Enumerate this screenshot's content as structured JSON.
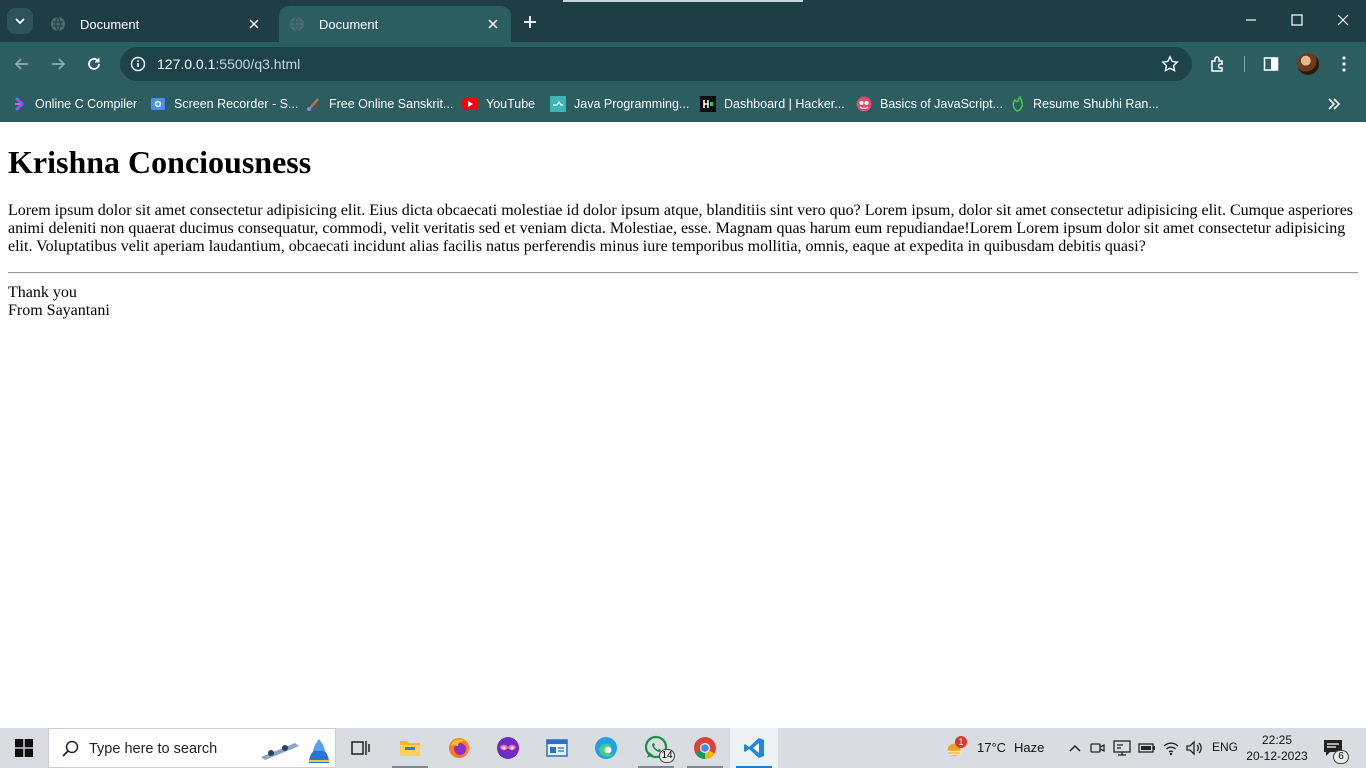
{
  "browser": {
    "tabs": [
      {
        "title": "Document",
        "active": false
      },
      {
        "title": "Document",
        "active": true
      }
    ],
    "address": {
      "host": "127.0.0.1",
      "path": ":5500/q3.html"
    },
    "bookmarks": [
      {
        "label": "Online C Compiler",
        "icon": "compiler-icon"
      },
      {
        "label": "Screen Recorder - S...",
        "icon": "screen-recorder-icon"
      },
      {
        "label": "Free Online Sanskrit...",
        "icon": "sanskrit-icon"
      },
      {
        "label": "YouTube",
        "icon": "youtube-icon"
      },
      {
        "label": "Java Programming...",
        "icon": "java-icon"
      },
      {
        "label": "Dashboard | Hacker...",
        "icon": "hackerrank-icon"
      },
      {
        "label": "Basics of JavaScript...",
        "icon": "javascript-course-icon"
      },
      {
        "label": "Resume Shubhi Ran...",
        "icon": "resume-icon"
      }
    ]
  },
  "page": {
    "heading": "Krishna Conciousness",
    "paragraph": "Lorem ipsum dolor sit amet consectetur adipisicing elit. Eius dicta obcaecati molestiae id dolor ipsum atque, blanditiis sint vero quo? Lorem ipsum, dolor sit amet consectetur adipisicing elit. Cumque asperiores animi deleniti non quaerat ducimus consequatur, commodi, velit veritatis sed et veniam dicta. Molestiae, esse. Magnam quas harum eum repudiandae!Lorem Lorem ipsum dolor sit amet consectetur adipisicing elit. Voluptatibus velit aperiam laudantium, obcaecati incidunt alias facilis natus perferendis minus iure temporibus mollitia, omnis, eaque at expedita in quibusdam debitis quasi?",
    "thanks": "Thank you",
    "from": "From Sayantani"
  },
  "taskbar": {
    "search_placeholder": "Type here to search",
    "whatsapp_badge": "14",
    "weather_alert": "1",
    "temperature": "17°C",
    "weather_condition": "Haze",
    "language": "ENG",
    "time": "22:25",
    "date": "20-12-2023",
    "notification_count": "6"
  },
  "colors": {
    "tabstrip": "#1e3d44",
    "toolbar": "#2c5d61",
    "omnibox": "#1d434a",
    "taskbar": "#d9dde2",
    "taskbar_active_indicator": "#1f7ad6"
  }
}
